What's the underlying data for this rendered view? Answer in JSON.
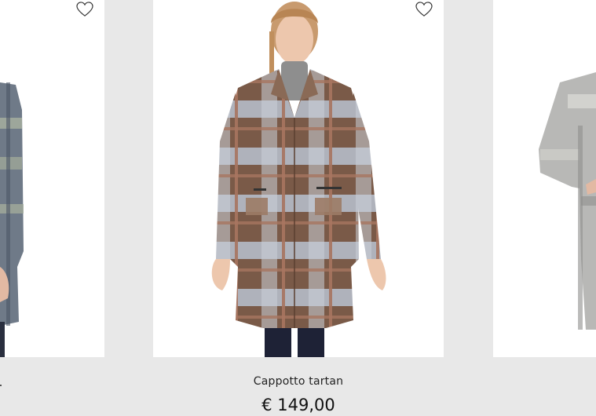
{
  "products": [
    {
      "id": "left",
      "colors": {
        "coat": "#7c8693"
      }
    },
    {
      "id": "center",
      "name": "Cappotto tartan",
      "price": "€ 149,00",
      "colors": {
        "coat_base": "#7a5a48",
        "check_light": "#b9c2cf"
      }
    },
    {
      "id": "right",
      "colors": {
        "coat": "#b8b8b6"
      }
    }
  ],
  "icons": {
    "favorite": "heart-outline-icon"
  },
  "colors": {
    "background": "#e8e8e8",
    "card": "#ffffff"
  }
}
